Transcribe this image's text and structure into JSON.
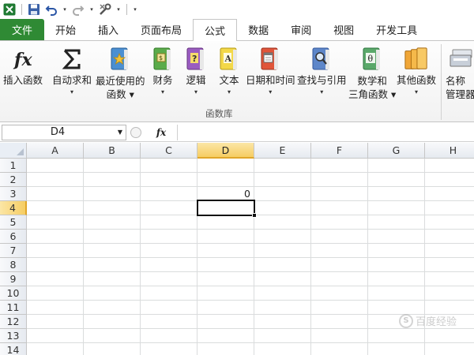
{
  "qat": {
    "undo_arrow": "▾",
    "redo_arrow": "▾",
    "customize": "▾"
  },
  "tabs": [
    "文件",
    "开始",
    "插入",
    "页面布局",
    "公式",
    "数据",
    "审阅",
    "视图",
    "开发工具"
  ],
  "ribbon": {
    "buttons": [
      {
        "label": "插入函数",
        "icon": "fx-icon",
        "arrow": ""
      },
      {
        "label": "自动求和",
        "icon": "sigma-icon",
        "arrow": "▾"
      },
      {
        "label": "最近使用的\n函数 ▾",
        "icon": "star-book-icon",
        "arrow": ""
      },
      {
        "label": "财务",
        "icon": "finance-book-icon",
        "arrow": "▾"
      },
      {
        "label": "逻辑",
        "icon": "logic-book-icon",
        "arrow": "▾"
      },
      {
        "label": "文本",
        "icon": "text-book-icon",
        "arrow": "▾"
      },
      {
        "label": "日期和时间",
        "icon": "datetime-book-icon",
        "arrow": "▾"
      },
      {
        "label": "查找与引用",
        "icon": "lookup-book-icon",
        "arrow": "▾"
      },
      {
        "label": "数学和\n三角函数 ▾",
        "icon": "math-book-icon",
        "arrow": ""
      },
      {
        "label": "其他函数",
        "icon": "other-book-icon",
        "arrow": "▾"
      },
      {
        "label": "名称\n管理器",
        "icon": "name-manager-icon",
        "arrow": ""
      }
    ],
    "group_label": "函数库"
  },
  "formula_bar": {
    "name_box": "D4",
    "fx": "fx",
    "content": ""
  },
  "grid": {
    "columns": [
      "A",
      "B",
      "C",
      "D",
      "E",
      "F",
      "G",
      "H"
    ],
    "rows": [
      "1",
      "2",
      "3",
      "4",
      "5",
      "6",
      "7",
      "8",
      "9",
      "10",
      "11",
      "12",
      "13",
      "14"
    ],
    "selected_column": "D",
    "selected_row": "4",
    "cells": {
      "D3": "0"
    }
  },
  "watermark": {
    "logo_text": "S",
    "text": "百度经验"
  },
  "colors": {
    "file_tab": "#2f8a34",
    "selection_header": "#f6cd63",
    "grid_line": "#dadcdd"
  }
}
